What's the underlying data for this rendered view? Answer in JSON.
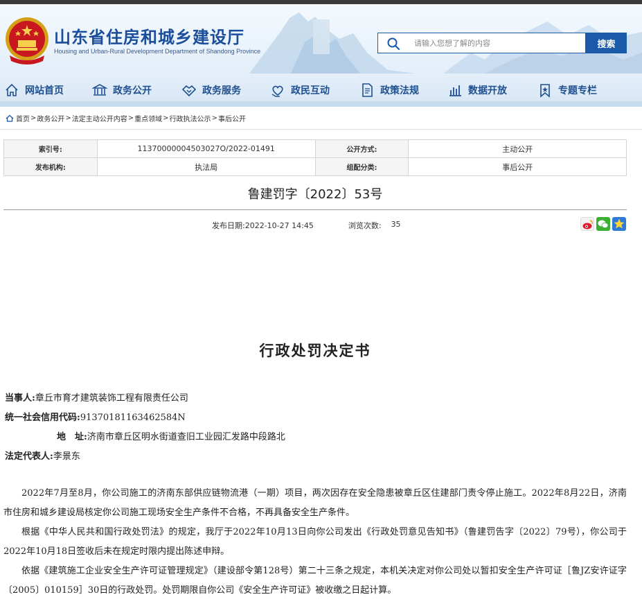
{
  "site": {
    "title": "山东省住房和城乡建设厅",
    "subtitle": "Housing and Urban-Rural Development Department of Shandong Province"
  },
  "search": {
    "placeholder": "请输入您想了解的内容",
    "button_label": "搜索"
  },
  "nav": {
    "items": [
      {
        "label": "网站首页",
        "icon": "home-icon"
      },
      {
        "label": "政务公开",
        "icon": "building-icon"
      },
      {
        "label": "政务服务",
        "icon": "handshake-icon"
      },
      {
        "label": "政民互动",
        "icon": "heart-hand-icon"
      },
      {
        "label": "政策法规",
        "icon": "document-icon"
      },
      {
        "label": "数据开放",
        "icon": "bar-chart-icon"
      },
      {
        "label": "专题专栏",
        "icon": "bookmark-icon"
      }
    ]
  },
  "breadcrumb": {
    "items": [
      "首页",
      "政务公开",
      "法定主动公开内容",
      "重点领域",
      "行政执法公示",
      "事后公开"
    ],
    "separator": ">"
  },
  "meta": {
    "index_label": "索引号:",
    "index_value": "11370000004503027O/2022-01491",
    "method_label": "公开方式:",
    "method_value": "主动公开",
    "issuer_label": "发布机构:",
    "issuer_value": "执法局",
    "category_label": "组配分类:",
    "category_value": "事后公开"
  },
  "document": {
    "number": "鲁建罚字〔2022〕53号",
    "publish_date": "发布日期:2022-10-27 14:45",
    "views_label": "浏览次数:",
    "views_value": "35",
    "heading": "行政处罚决定书",
    "party_label": "当事人:",
    "party_value": "章丘市育才建筑装饰工程有限责任公司",
    "credit_label": "统一社会信用代码:",
    "credit_value": "91370181163462584N",
    "address_label": "地　址:",
    "address_value": "济南市章丘区明水街道查旧工业园汇发路中段路北",
    "rep_label": "法定代表人:",
    "rep_value": "李景东",
    "paragraphs": [
      "2022年7月至8月，你公司施工的济南东部供应链物流港（一期）项目，两次因存在安全隐患被章丘区住建部门责令停止施工。2022年8月22日，济南市住房和城乡建设局核定你公司施工现场安全生产条件不合格，不再具备安全生产条件。",
      "根据《中华人民共和国行政处罚法》的规定，我厅于2022年10月13日向你公司发出《行政处罚意见告知书》（鲁建罚告字〔2022〕79号），你公司于2022年10月18日签收后未在规定时限内提出陈述申辩。",
      "依据《建筑施工企业安全生产许可证管理规定》（建设部令第128号）第二十三条之规定，本机关决定对你公司处以暂扣安全生产许可证［鲁JZ安许证字〔2005〕010159］30日的行政处罚。处罚期限自你公司《安全生产许可证》被收缴之日起计算。"
    ]
  },
  "colors": {
    "brand_blue": "#1a5aa8",
    "nav_text": "#1e4f8f"
  }
}
